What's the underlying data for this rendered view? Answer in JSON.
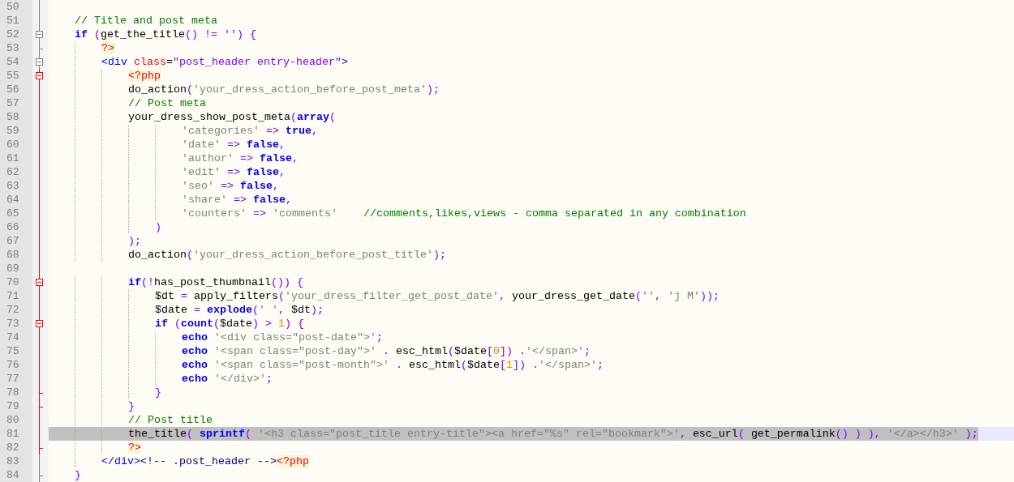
{
  "lines": [
    {
      "number": "50",
      "fold": {
        "kind": "line",
        "active": false
      },
      "selected": false
    },
    {
      "number": "51",
      "fold": {
        "kind": "line",
        "active": false
      },
      "selected": false,
      "tokens": [
        {
          "kind": "comment",
          "text": "    // Title and post meta"
        }
      ]
    },
    {
      "number": "52",
      "fold": {
        "kind": "box",
        "active": false
      },
      "selected": false,
      "tokens": [
        {
          "kind": "keyword",
          "text": "    if"
        },
        {
          "kind": "op",
          "text": " ("
        },
        {
          "kind": "plain",
          "text": "get_the_title"
        },
        {
          "kind": "op",
          "text": "() != '') {"
        }
      ]
    },
    {
      "number": "53",
      "fold": {
        "kind": "end",
        "active": false
      },
      "selected": false,
      "tokens": [
        {
          "kind": "php",
          "text": "        ?>"
        }
      ]
    },
    {
      "number": "54",
      "fold": {
        "kind": "box",
        "active": false
      },
      "selected": false,
      "tokens": [
        {
          "kind": "tag",
          "text": "        <div"
        },
        {
          "kind": "attr",
          "text": " class"
        },
        {
          "kind": "plain",
          "text": "="
        },
        {
          "kind": "value",
          "text": "\"post_header entry-header\""
        },
        {
          "kind": "tag",
          "text": ">"
        }
      ]
    },
    {
      "number": "55",
      "fold": {
        "kind": "box",
        "active": true
      },
      "selected": false,
      "tokens": [
        {
          "kind": "php",
          "text": "            <?php"
        }
      ]
    },
    {
      "number": "56",
      "fold": {
        "kind": "line",
        "active": true
      },
      "selected": false,
      "tokens": [
        {
          "kind": "plain",
          "text": "            do_action"
        },
        {
          "kind": "op",
          "text": "("
        },
        {
          "kind": "string",
          "text": "'your_dress_action_before_post_meta'"
        },
        {
          "kind": "op",
          "text": ");"
        }
      ]
    },
    {
      "number": "57",
      "fold": {
        "kind": "line",
        "active": true
      },
      "selected": false,
      "tokens": [
        {
          "kind": "comment",
          "text": "            // Post meta"
        }
      ]
    },
    {
      "number": "58",
      "fold": {
        "kind": "line",
        "active": true
      },
      "selected": false,
      "tokens": [
        {
          "kind": "plain",
          "text": "            your_dress_show_post_meta"
        },
        {
          "kind": "op",
          "text": "("
        },
        {
          "kind": "keyword",
          "text": "array"
        },
        {
          "kind": "op",
          "text": "("
        }
      ]
    },
    {
      "number": "59",
      "fold": {
        "kind": "line",
        "active": true
      },
      "selected": false,
      "tokens": [
        {
          "kind": "string",
          "text": "                    'categories'"
        },
        {
          "kind": "op",
          "text": " => "
        },
        {
          "kind": "keyword",
          "text": "true"
        },
        {
          "kind": "op",
          "text": ","
        }
      ]
    },
    {
      "number": "60",
      "fold": {
        "kind": "line",
        "active": true
      },
      "selected": false,
      "tokens": [
        {
          "kind": "string",
          "text": "                    'date'"
        },
        {
          "kind": "op",
          "text": " => "
        },
        {
          "kind": "keyword",
          "text": "false"
        },
        {
          "kind": "op",
          "text": ","
        }
      ]
    },
    {
      "number": "61",
      "fold": {
        "kind": "line",
        "active": true
      },
      "selected": false,
      "tokens": [
        {
          "kind": "string",
          "text": "                    'author'"
        },
        {
          "kind": "op",
          "text": " => "
        },
        {
          "kind": "keyword",
          "text": "false"
        },
        {
          "kind": "op",
          "text": ","
        }
      ]
    },
    {
      "number": "62",
      "fold": {
        "kind": "line",
        "active": true
      },
      "selected": false,
      "tokens": [
        {
          "kind": "string",
          "text": "                    'edit'"
        },
        {
          "kind": "op",
          "text": " => "
        },
        {
          "kind": "keyword",
          "text": "false"
        },
        {
          "kind": "op",
          "text": ","
        }
      ]
    },
    {
      "number": "63",
      "fold": {
        "kind": "line",
        "active": true
      },
      "selected": false,
      "tokens": [
        {
          "kind": "string",
          "text": "                    'seo'"
        },
        {
          "kind": "op",
          "text": " => "
        },
        {
          "kind": "keyword",
          "text": "false"
        },
        {
          "kind": "op",
          "text": ","
        }
      ]
    },
    {
      "number": "64",
      "fold": {
        "kind": "line",
        "active": true
      },
      "selected": false,
      "tokens": [
        {
          "kind": "string",
          "text": "                    'share'"
        },
        {
          "kind": "op",
          "text": " => "
        },
        {
          "kind": "keyword",
          "text": "false"
        },
        {
          "kind": "op",
          "text": ","
        }
      ]
    },
    {
      "number": "65",
      "fold": {
        "kind": "line",
        "active": true
      },
      "selected": false,
      "tokens": [
        {
          "kind": "string",
          "text": "                    'counters'"
        },
        {
          "kind": "op",
          "text": " => "
        },
        {
          "kind": "string",
          "text": "'comments'"
        },
        {
          "kind": "comment",
          "text": "    //comments,likes,views - comma separated in any combination"
        }
      ]
    },
    {
      "number": "66",
      "fold": {
        "kind": "line",
        "active": true
      },
      "selected": false,
      "tokens": [
        {
          "kind": "op",
          "text": "                )"
        }
      ]
    },
    {
      "number": "67",
      "fold": {
        "kind": "line",
        "active": true
      },
      "selected": false,
      "tokens": [
        {
          "kind": "op",
          "text": "            );"
        }
      ]
    },
    {
      "number": "68",
      "fold": {
        "kind": "line",
        "active": true
      },
      "selected": false,
      "tokens": [
        {
          "kind": "plain",
          "text": "            do_action"
        },
        {
          "kind": "op",
          "text": "("
        },
        {
          "kind": "string",
          "text": "'your_dress_action_before_post_title'"
        },
        {
          "kind": "op",
          "text": ");"
        }
      ]
    },
    {
      "number": "69",
      "fold": {
        "kind": "line",
        "active": true
      },
      "selected": false
    },
    {
      "number": "70",
      "fold": {
        "kind": "box",
        "active": true
      },
      "selected": false,
      "tokens": [
        {
          "kind": "keyword",
          "text": "            if"
        },
        {
          "kind": "op",
          "text": "(!"
        },
        {
          "kind": "plain",
          "text": "has_post_thumbnail"
        },
        {
          "kind": "op",
          "text": "()) {"
        }
      ]
    },
    {
      "number": "71",
      "fold": {
        "kind": "line",
        "active": true
      },
      "selected": false,
      "tokens": [
        {
          "kind": "plain",
          "text": "                $dt "
        },
        {
          "kind": "op",
          "text": "="
        },
        {
          "kind": "plain",
          "text": " apply_filters"
        },
        {
          "kind": "op",
          "text": "("
        },
        {
          "kind": "string",
          "text": "'your_dress_filter_get_post_date'"
        },
        {
          "kind": "op",
          "text": ", "
        },
        {
          "kind": "plain",
          "text": "your_dress_get_date"
        },
        {
          "kind": "op",
          "text": "("
        },
        {
          "kind": "string",
          "text": "''"
        },
        {
          "kind": "op",
          "text": ", "
        },
        {
          "kind": "string",
          "text": "'j M'"
        },
        {
          "kind": "op",
          "text": "));"
        }
      ]
    },
    {
      "number": "72",
      "fold": {
        "kind": "line",
        "active": true
      },
      "selected": false,
      "tokens": [
        {
          "kind": "plain",
          "text": "                $date "
        },
        {
          "kind": "op",
          "text": "= "
        },
        {
          "kind": "keyword",
          "text": "explode"
        },
        {
          "kind": "op",
          "text": "("
        },
        {
          "kind": "string",
          "text": "' '"
        },
        {
          "kind": "op",
          "text": ", "
        },
        {
          "kind": "plain",
          "text": "$dt"
        },
        {
          "kind": "op",
          "text": ");"
        }
      ]
    },
    {
      "number": "73",
      "fold": {
        "kind": "box",
        "active": true
      },
      "selected": false,
      "tokens": [
        {
          "kind": "keyword",
          "text": "                if"
        },
        {
          "kind": "op",
          "text": " ("
        },
        {
          "kind": "keyword",
          "text": "count"
        },
        {
          "kind": "op",
          "text": "("
        },
        {
          "kind": "plain",
          "text": "$date"
        },
        {
          "kind": "op",
          "text": ") > "
        },
        {
          "kind": "number",
          "text": "1"
        },
        {
          "kind": "op",
          "text": ") {"
        }
      ]
    },
    {
      "number": "74",
      "fold": {
        "kind": "line",
        "active": true
      },
      "selected": false,
      "tokens": [
        {
          "kind": "keyword",
          "text": "                    echo"
        },
        {
          "kind": "string",
          "text": " '<div class=\"post-date\">'"
        },
        {
          "kind": "op",
          "text": ";"
        }
      ]
    },
    {
      "number": "75",
      "fold": {
        "kind": "line",
        "active": true
      },
      "selected": false,
      "tokens": [
        {
          "kind": "keyword",
          "text": "                    echo"
        },
        {
          "kind": "string",
          "text": " '<span class=\"post-day\">'"
        },
        {
          "kind": "op",
          "text": " . "
        },
        {
          "kind": "plain",
          "text": "esc_html"
        },
        {
          "kind": "op",
          "text": "("
        },
        {
          "kind": "plain",
          "text": "$date"
        },
        {
          "kind": "op",
          "text": "["
        },
        {
          "kind": "number",
          "text": "0"
        },
        {
          "kind": "op",
          "text": "]) ."
        },
        {
          "kind": "string",
          "text": "'</span>'"
        },
        {
          "kind": "op",
          "text": ";"
        }
      ]
    },
    {
      "number": "76",
      "fold": {
        "kind": "line",
        "active": true
      },
      "selected": false,
      "tokens": [
        {
          "kind": "keyword",
          "text": "                    echo"
        },
        {
          "kind": "string",
          "text": " '<span class=\"post-month\">'"
        },
        {
          "kind": "op",
          "text": " . "
        },
        {
          "kind": "plain",
          "text": "esc_html"
        },
        {
          "kind": "op",
          "text": "("
        },
        {
          "kind": "plain",
          "text": "$date"
        },
        {
          "kind": "op",
          "text": "["
        },
        {
          "kind": "number",
          "text": "1"
        },
        {
          "kind": "op",
          "text": "]) ."
        },
        {
          "kind": "string",
          "text": "'</span>'"
        },
        {
          "kind": "op",
          "text": ";"
        }
      ]
    },
    {
      "number": "77",
      "fold": {
        "kind": "line",
        "active": true
      },
      "selected": false,
      "tokens": [
        {
          "kind": "keyword",
          "text": "                    echo"
        },
        {
          "kind": "string",
          "text": " '</div>'"
        },
        {
          "kind": "op",
          "text": ";"
        }
      ]
    },
    {
      "number": "78",
      "fold": {
        "kind": "end",
        "active": true
      },
      "selected": false,
      "tokens": [
        {
          "kind": "op",
          "text": "                }"
        }
      ]
    },
    {
      "number": "79",
      "fold": {
        "kind": "end",
        "active": true
      },
      "selected": false,
      "tokens": [
        {
          "kind": "op",
          "text": "            }"
        }
      ]
    },
    {
      "number": "80",
      "fold": {
        "kind": "line",
        "active": true
      },
      "selected": false,
      "tokens": [
        {
          "kind": "comment",
          "text": "            // Post title"
        }
      ]
    },
    {
      "number": "81",
      "fold": {
        "kind": "line",
        "active": true
      },
      "selected": true,
      "tokens": [
        {
          "kind": "plain",
          "text": "            the_title"
        },
        {
          "kind": "op",
          "text": "( "
        },
        {
          "kind": "keyword",
          "text": "sprintf"
        },
        {
          "kind": "op",
          "text": "( "
        },
        {
          "kind": "string",
          "text": "'<h3 class=\"post_title entry-title\"><a href=\"%s\" rel=\"bookmark\">'"
        },
        {
          "kind": "op",
          "text": ", "
        },
        {
          "kind": "plain",
          "text": "esc_url"
        },
        {
          "kind": "op",
          "text": "( "
        },
        {
          "kind": "plain",
          "text": "get_permalink"
        },
        {
          "kind": "op",
          "text": "() ) ), "
        },
        {
          "kind": "string",
          "text": "'</a></h3>'"
        },
        {
          "kind": "op",
          "text": " );"
        }
      ]
    },
    {
      "number": "82",
      "fold": {
        "kind": "end",
        "active": true
      },
      "selected": false,
      "tokens": [
        {
          "kind": "php",
          "text": "            ?>"
        }
      ]
    },
    {
      "number": "83",
      "fold": {
        "kind": "line",
        "active": false
      },
      "selected": false,
      "tokens": [
        {
          "kind": "tag",
          "text": "        </div>"
        },
        {
          "kind": "html_comment",
          "text": "<!-- .post_header -->"
        },
        {
          "kind": "php",
          "text": "<?php"
        }
      ]
    },
    {
      "number": "84",
      "fold": {
        "kind": "end",
        "active": false
      },
      "selected": false,
      "tokens": [
        {
          "kind": "op",
          "text": "    }"
        }
      ]
    }
  ]
}
